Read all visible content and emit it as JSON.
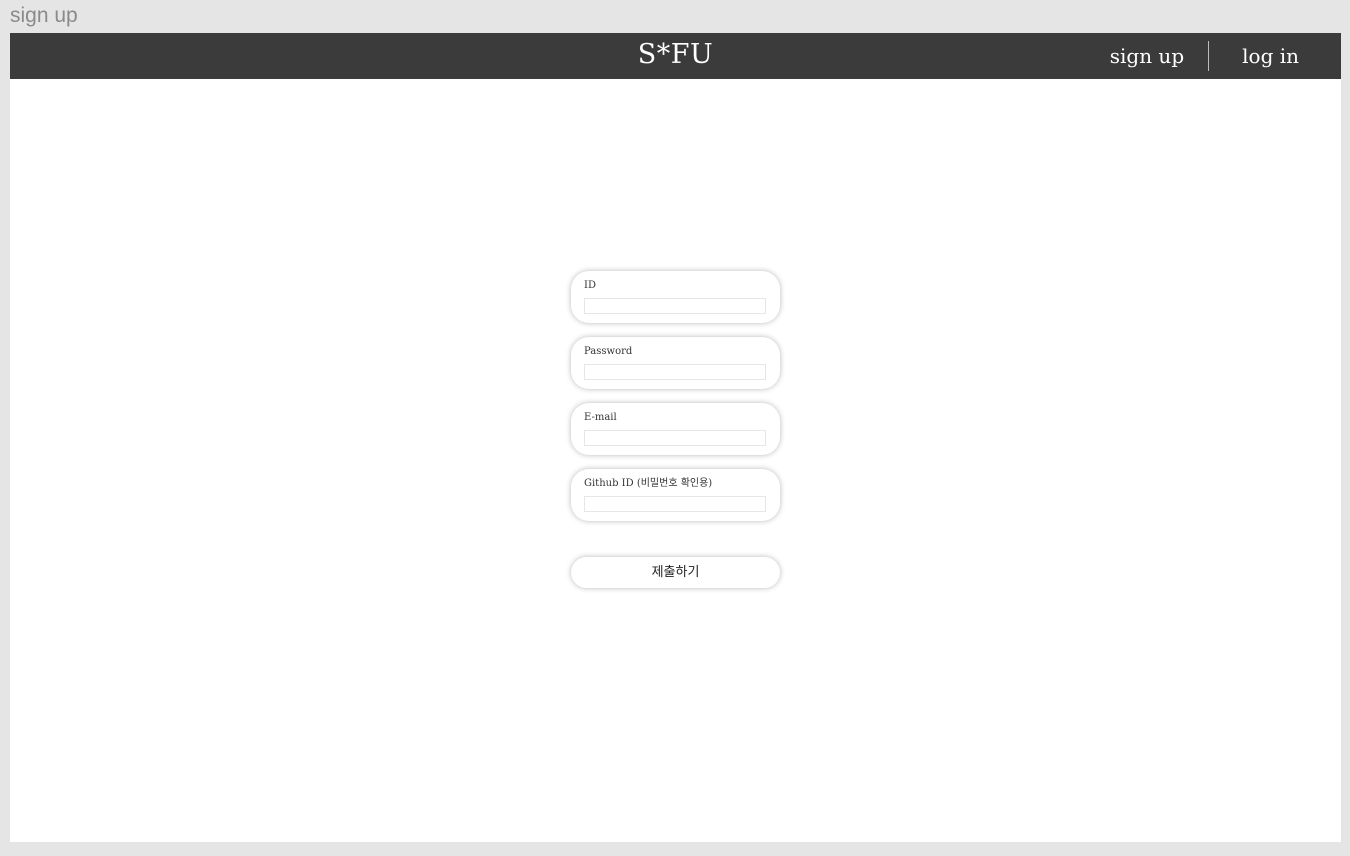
{
  "window": {
    "title": "sign up"
  },
  "navbar": {
    "brand": "S*FU",
    "links": [
      {
        "label": "sign up"
      },
      {
        "label": "log in"
      }
    ]
  },
  "form": {
    "fields": [
      {
        "label": "ID",
        "value": "",
        "placeholder": ""
      },
      {
        "label": "Password",
        "value": "",
        "placeholder": ""
      },
      {
        "label": "E-mail",
        "value": "",
        "placeholder": ""
      },
      {
        "label": "Github ID (비밀번호 확인용)",
        "value": "",
        "placeholder": ""
      }
    ],
    "submit_label": "제출하기"
  },
  "colors": {
    "navbar_bg": "#3b3b3b",
    "page_bg": "#e5e5e5",
    "content_bg": "#ffffff"
  }
}
